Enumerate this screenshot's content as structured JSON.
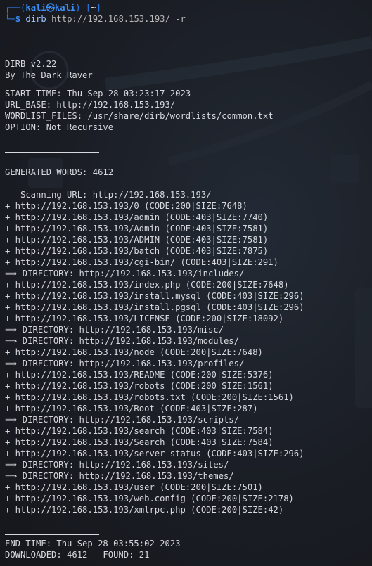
{
  "prompt": {
    "corner_top": "┌──(",
    "user": "kali",
    "at": "㉿",
    "host": "kali",
    "paren_close": ")-[",
    "path": "~",
    "bracket_close": "]",
    "corner_bottom": "└─",
    "dollar": "$ ",
    "command": "dirb",
    "args": " http://192.168.153.193/ ",
    "flag": "-r"
  },
  "banner": {
    "title": "DIRB v2.22",
    "author": "By The Dark Raver"
  },
  "info": [
    "START_TIME: Thu Sep 28 03:23:17 2023",
    "URL_BASE: http://192.168.153.193/",
    "WORDLIST_FILES: /usr/share/dirb/wordlists/common.txt",
    "OPTION: Not Recursive"
  ],
  "generated_words": "GENERATED WORDS: 4612",
  "scanning_line": "—— Scanning URL: http://192.168.153.193/ ——",
  "results": [
    "+ http://192.168.153.193/0 (CODE:200|SIZE:7648)",
    "+ http://192.168.153.193/admin (CODE:403|SIZE:7740)",
    "+ http://192.168.153.193/Admin (CODE:403|SIZE:7581)",
    "+ http://192.168.153.193/ADMIN (CODE:403|SIZE:7581)",
    "+ http://192.168.153.193/batch (CODE:403|SIZE:7875)",
    "+ http://192.168.153.193/cgi-bin/ (CODE:403|SIZE:291)",
    "⟹ DIRECTORY: http://192.168.153.193/includes/",
    "+ http://192.168.153.193/index.php (CODE:200|SIZE:7648)",
    "+ http://192.168.153.193/install.mysql (CODE:403|SIZE:296)",
    "+ http://192.168.153.193/install.pgsql (CODE:403|SIZE:296)",
    "+ http://192.168.153.193/LICENSE (CODE:200|SIZE:18092)",
    "⟹ DIRECTORY: http://192.168.153.193/misc/",
    "⟹ DIRECTORY: http://192.168.153.193/modules/",
    "+ http://192.168.153.193/node (CODE:200|SIZE:7648)",
    "⟹ DIRECTORY: http://192.168.153.193/profiles/",
    "+ http://192.168.153.193/README (CODE:200|SIZE:5376)",
    "+ http://192.168.153.193/robots (CODE:200|SIZE:1561)",
    "+ http://192.168.153.193/robots.txt (CODE:200|SIZE:1561)",
    "+ http://192.168.153.193/Root (CODE:403|SIZE:287)",
    "⟹ DIRECTORY: http://192.168.153.193/scripts/",
    "+ http://192.168.153.193/search (CODE:403|SIZE:7584)",
    "+ http://192.168.153.193/Search (CODE:403|SIZE:7584)",
    "+ http://192.168.153.193/server-status (CODE:403|SIZE:296)",
    "⟹ DIRECTORY: http://192.168.153.193/sites/",
    "⟹ DIRECTORY: http://192.168.153.193/themes/",
    "+ http://192.168.153.193/user (CODE:200|SIZE:7501)",
    "+ http://192.168.153.193/web.config (CODE:200|SIZE:2178)",
    "+ http://192.168.153.193/xmlrpc.php (CODE:200|SIZE:42)"
  ],
  "footer": {
    "end_time": "END_TIME: Thu Sep 28 03:55:02 2023",
    "summary": "DOWNLOADED: 4612 - FOUND: 21"
  },
  "colors": {
    "background": "#1b1e26",
    "text": "#d7d9de",
    "prompt_blue": "#3b8ef5",
    "command": "#9fc3ff"
  }
}
